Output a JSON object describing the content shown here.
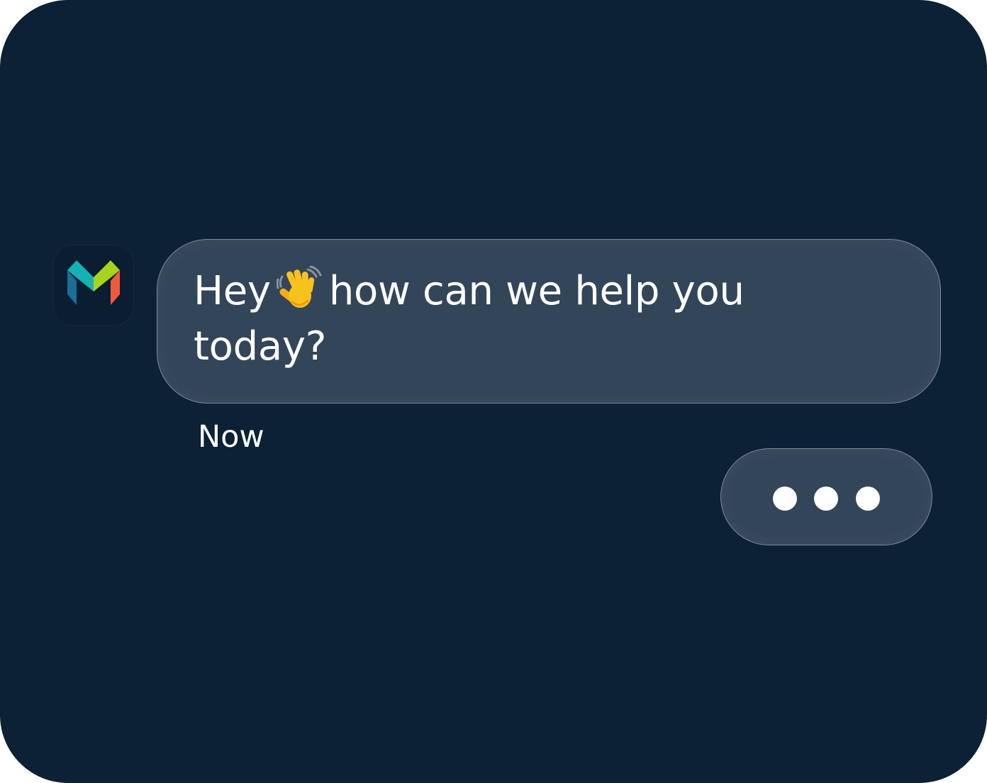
{
  "chat": {
    "avatar": {
      "icon": "monzo-logo-icon"
    },
    "message": {
      "text_before": "Hey",
      "emoji": "waving-hand",
      "text_after": "how can we help you today?",
      "timestamp": "Now"
    },
    "typing_indicator": {
      "icon": "typing-dots-icon"
    }
  },
  "colors": {
    "background": "#0c2036",
    "bubble": "#334559",
    "text": "#ffffff",
    "logo_teal": "#14b3b3",
    "logo_blue": "#1a6f96",
    "logo_green": "#a8d21e",
    "logo_red": "#ef5a3c"
  }
}
